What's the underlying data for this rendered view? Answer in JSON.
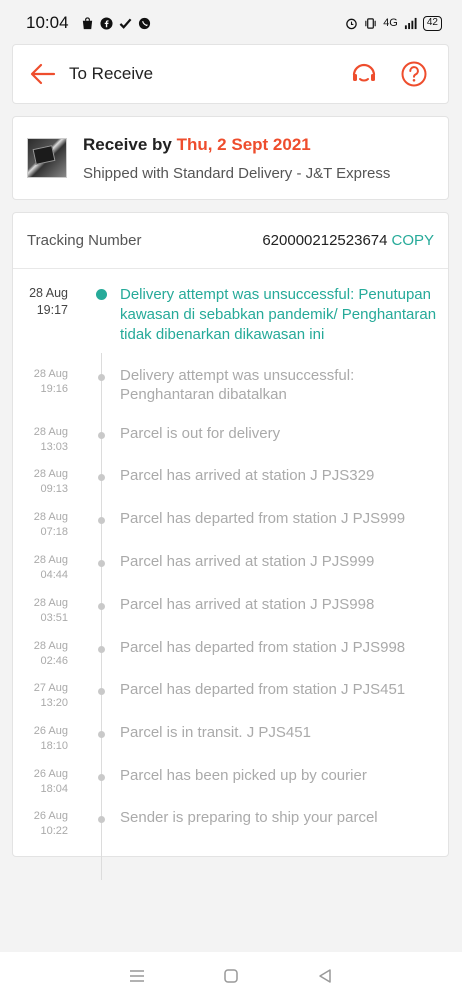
{
  "status_bar": {
    "time": "10:04",
    "battery": "42",
    "network": "4G"
  },
  "header": {
    "title": "To Receive",
    "accent_color": "#ee4d2d"
  },
  "receive": {
    "prefix": "Receive by",
    "date": "Thu, 2 Sept 2021",
    "shipping": "Shipped with Standard Delivery  - J&T Express"
  },
  "tracking": {
    "label": "Tracking Number",
    "number": "620000212523674",
    "copy_label": "COPY",
    "accent_color": "#26aa99",
    "events": [
      {
        "date": "28 Aug",
        "time": "19:17",
        "text": "Delivery attempt was unsuccessful: Penutupan kawasan di sebabkan pandemik/ Penghantaran tidak dibenarkan dikawasan ini"
      },
      {
        "date": "28 Aug",
        "time": "19:16",
        "text": "Delivery attempt was unsuccessful: Penghantaran dibatalkan"
      },
      {
        "date": "28 Aug",
        "time": "13:03",
        "text": "Parcel is out for delivery"
      },
      {
        "date": "28 Aug",
        "time": "09:13",
        "text": "Parcel has arrived at station J PJS329"
      },
      {
        "date": "28 Aug",
        "time": "07:18",
        "text": "Parcel has departed from station J PJS999"
      },
      {
        "date": "28 Aug",
        "time": "04:44",
        "text": "Parcel has arrived at station J PJS999"
      },
      {
        "date": "28 Aug",
        "time": "03:51",
        "text": "Parcel has arrived at station J PJS998"
      },
      {
        "date": "28 Aug",
        "time": "02:46",
        "text": "Parcel has departed from station J PJS998"
      },
      {
        "date": "27 Aug",
        "time": "13:20",
        "text": "Parcel has departed from station J PJS451"
      },
      {
        "date": "26 Aug",
        "time": "18:10",
        "text": "Parcel is in transit. J PJS451"
      },
      {
        "date": "26 Aug",
        "time": "18:04",
        "text": "Parcel has been picked up by courier"
      },
      {
        "date": "26 Aug",
        "time": "10:22",
        "text": "Sender is preparing to ship your parcel"
      }
    ]
  }
}
